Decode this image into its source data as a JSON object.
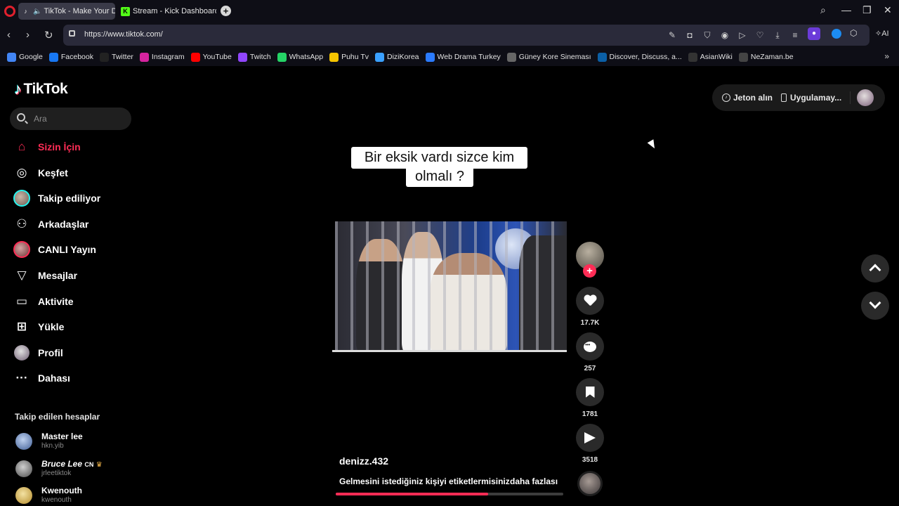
{
  "browser": {
    "tabs": [
      {
        "label": "TikTok - Make Your Da",
        "active": true
      },
      {
        "label": "Stream - Kick Dashboard",
        "active": false
      }
    ],
    "url": "https://www.tiktok.com/",
    "bookmarks": [
      {
        "label": "Google",
        "icon": "google-icon",
        "color": "#4285f4"
      },
      {
        "label": "Facebook",
        "icon": "facebook-icon",
        "color": "#1877f2"
      },
      {
        "label": "Twitter",
        "icon": "x-icon",
        "color": "#222222"
      },
      {
        "label": "Instagram",
        "icon": "instagram-icon",
        "color": "#d6249f"
      },
      {
        "label": "YouTube",
        "icon": "youtube-icon",
        "color": "#ff0000"
      },
      {
        "label": "Twitch",
        "icon": "twitch-icon",
        "color": "#9146ff"
      },
      {
        "label": "WhatsApp",
        "icon": "whatsapp-icon",
        "color": "#25d366"
      },
      {
        "label": "Puhu Tv",
        "icon": "puhutv-icon",
        "color": "#f5c400"
      },
      {
        "label": "DiziKorea",
        "icon": "dizikorea-icon",
        "color": "#3aa0ff"
      },
      {
        "label": "Web Drama Turkey",
        "icon": "webdrama-icon",
        "color": "#2b7bff"
      },
      {
        "label": "Güney Kore Sineması",
        "icon": "kore-sinema-icon",
        "color": "#666666"
      },
      {
        "label": "Discover, Discuss, a...",
        "icon": "mdl-icon",
        "color": "#0b5fa5"
      },
      {
        "label": "AsianWiki",
        "icon": "asianwiki-icon",
        "color": "#333333"
      },
      {
        "label": "NeZaman.be",
        "icon": "nezaman-icon",
        "color": "#444444"
      }
    ]
  },
  "tiktok": {
    "logo": "TikTok",
    "search_placeholder": "Ara",
    "nav": [
      {
        "label": "Sizin İçin",
        "icon": "home-icon",
        "glyph": "⌂",
        "active": true
      },
      {
        "label": "Keşfet",
        "icon": "compass-icon",
        "glyph": "◎",
        "active": false
      },
      {
        "label": "Takip ediliyor",
        "icon": "following-avatar-icon",
        "glyph": "",
        "active": false
      },
      {
        "label": "Arkadaşlar",
        "icon": "friends-icon",
        "glyph": "⚇",
        "active": false
      },
      {
        "label": "CANLI Yayın",
        "icon": "live-avatar-icon",
        "glyph": "",
        "active": false
      },
      {
        "label": "Mesajlar",
        "icon": "messages-icon",
        "glyph": "▽",
        "active": false
      },
      {
        "label": "Aktivite",
        "icon": "activity-icon",
        "glyph": "▭",
        "active": false
      },
      {
        "label": "Yükle",
        "icon": "upload-icon",
        "glyph": "⊞",
        "active": false
      },
      {
        "label": "Profil",
        "icon": "profile-avatar-icon",
        "glyph": "",
        "active": false
      },
      {
        "label": "Dahası",
        "icon": "more-icon",
        "glyph": "···",
        "active": false
      }
    ],
    "following_heading": "Takip edilen hesaplar",
    "following": [
      {
        "name": "Master lee",
        "username": "hkn.yib",
        "badge": ""
      },
      {
        "name": "Bruce Lee",
        "username": "jrleetiktok",
        "badge": "CN"
      },
      {
        "name": "Kwenouth",
        "username": "kwenouth",
        "badge": ""
      }
    ],
    "top_right": {
      "coins": "Jeton alın",
      "app": "Uygulamay..."
    },
    "video": {
      "caption_line1": "Bir eksik vardı sizce kim",
      "caption_line2": "olmalı ?",
      "creator": "denizz.432",
      "description": "Gelmesini istediğiniz kişiyi etiketlermisiniz",
      "more": "daha fazlası",
      "playback_progress": 0.67,
      "likes": "17.7K",
      "comments": "257",
      "saves": "1781",
      "shares": "3518"
    }
  }
}
